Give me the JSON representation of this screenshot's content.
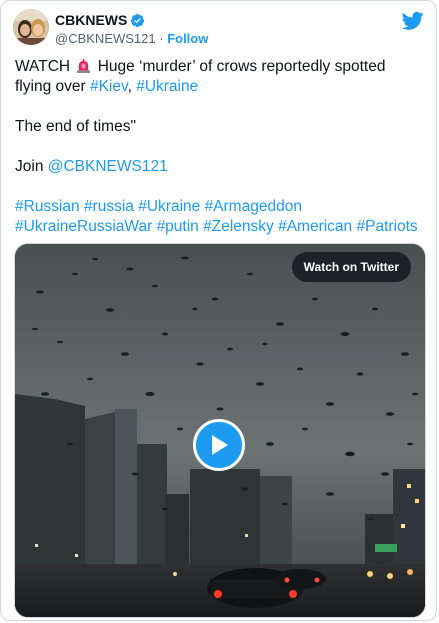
{
  "tweet": {
    "display_name": "CBKNEWS",
    "handle": "@CBKNEWS121",
    "separator": " · ",
    "follow_label": "Follow",
    "line1_prefix": "WATCH ",
    "line1_suffix": " Huge ‘murder’ of crows reportedly spotted",
    "line2_prefix": "flying over ",
    "tag_kiev": "#Kiev",
    "comma": ", ",
    "tag_ukraine": "#Ukraine",
    "line3": "The end of times\"",
    "join_prefix": "Join ",
    "join_mention": "@CBKNEWS121",
    "hashtags_row1": [
      "#Russian",
      "#russia",
      "#Ukraine",
      "#Armageddon"
    ],
    "hashtags_row2": [
      "#UkraineRussiaWar",
      "#putin",
      "#Zelensky",
      "#American",
      "#Patriots"
    ]
  },
  "media": {
    "watch_label": "Watch on Twitter"
  },
  "icons": {
    "verified": "verified-badge-icon",
    "twitter": "twitter-bird-icon",
    "siren": "siren-emoji-icon",
    "play": "play-icon"
  },
  "colors": {
    "accent": "#1d9bf0",
    "text": "#0f1419",
    "muted": "#536471"
  }
}
